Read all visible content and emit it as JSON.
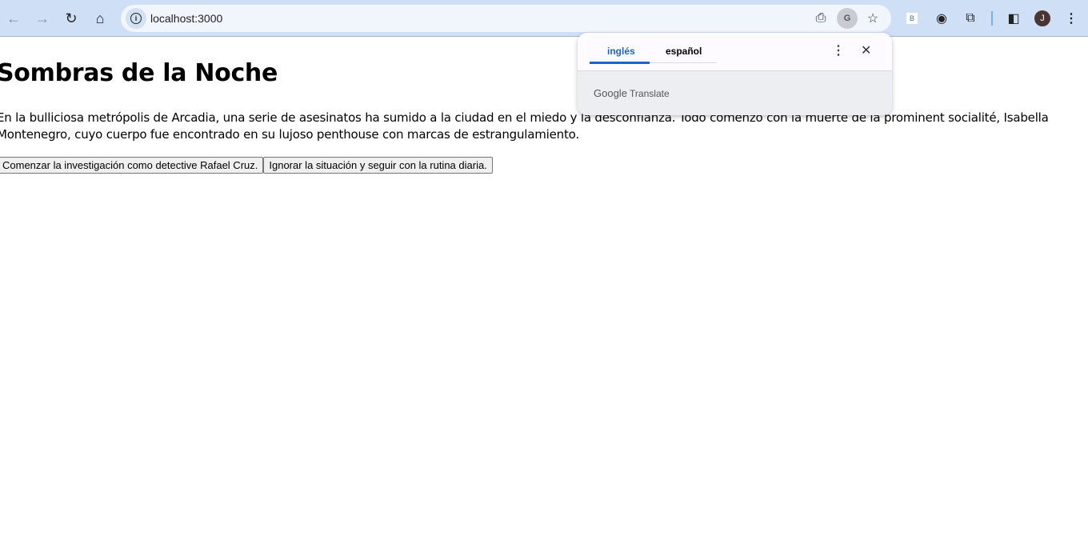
{
  "browser": {
    "url": "localhost:3000",
    "profile_initial": "J",
    "extension_badge": "B",
    "icons": [
      "back-icon",
      "forward-icon",
      "reload-icon",
      "home-icon",
      "site-info-icon",
      "install-app-icon",
      "translate-icon",
      "bookmark-star-icon",
      "extension-b-icon",
      "cookie-extension-icon",
      "extensions-puzzle-icon",
      "side-panel-icon",
      "avatar",
      "menu-kebab-icon"
    ]
  },
  "translate_popup": {
    "tabs": [
      {
        "label": "inglés",
        "active": true
      },
      {
        "label": "español",
        "active": false
      }
    ],
    "brand": "Google",
    "brand_suffix": "Translate"
  },
  "page": {
    "title": "Sombras de la Noche",
    "paragraph": "En la bulliciosa metrópolis de Arcadia, una serie de asesinatos ha sumido a la ciudad en el miedo y la desconfianza. Todo comenzó con la muerte de la prominent socialité, Isabella Montenegro, cuyo cuerpo fue encontrado en su lujoso penthouse con marcas de estrangulamiento.",
    "choices": [
      "Comenzar la investigación como detective Rafael Cruz.",
      "Ignorar la situación y seguir con la rutina diaria."
    ]
  }
}
